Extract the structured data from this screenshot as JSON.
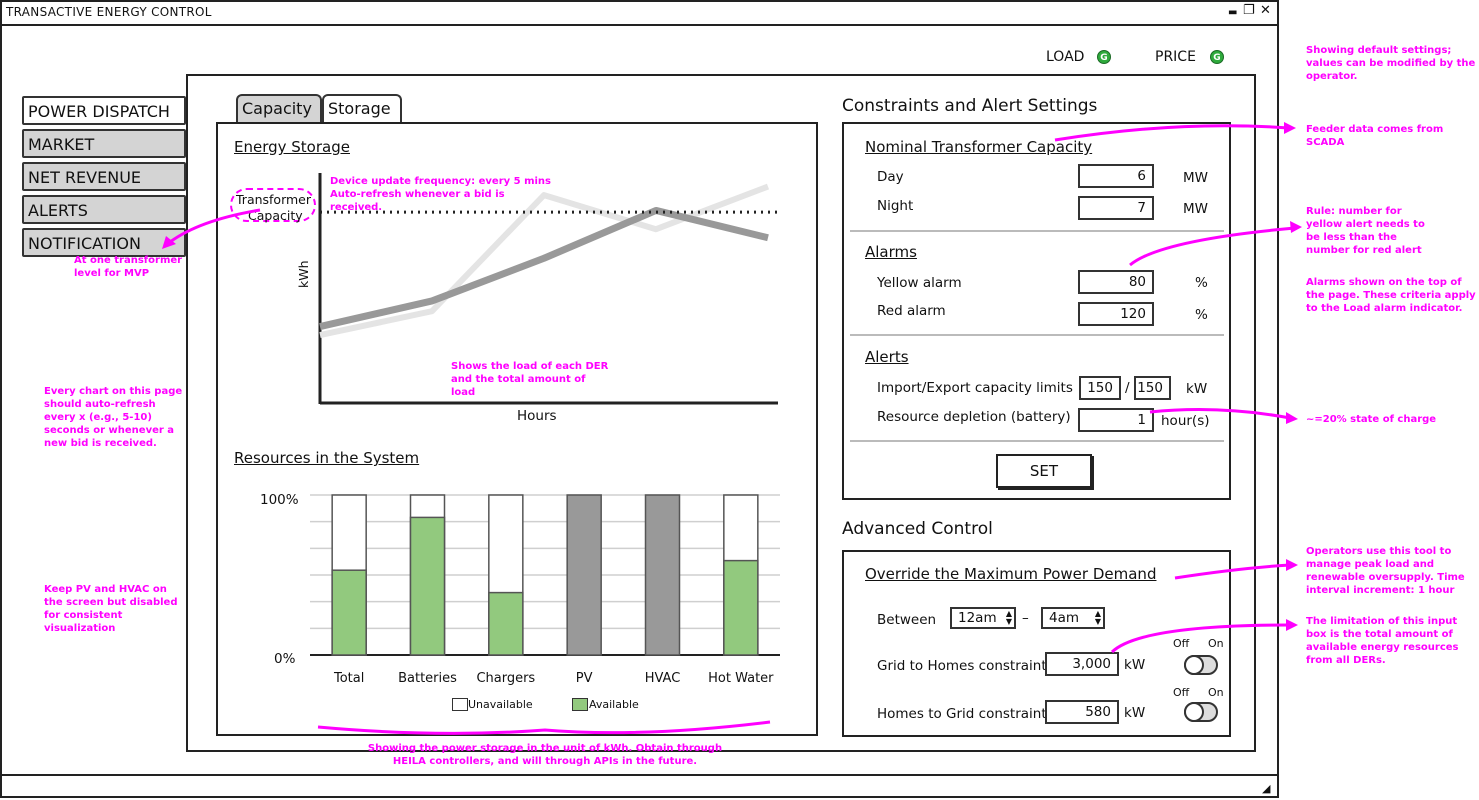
{
  "window": {
    "title": "TRANSACTIVE ENERGY CONTROL",
    "controls": [
      "▬",
      "❐",
      "✕"
    ]
  },
  "status": {
    "load_label": "LOAD",
    "load_indicator": "G",
    "price_label": "PRICE",
    "price_indicator": "G",
    "indicator_color": "#2eaa3c"
  },
  "nav": {
    "items": [
      {
        "label": "POWER DISPATCH",
        "active": true
      },
      {
        "label": "MARKET",
        "active": false
      },
      {
        "label": "NET REVENUE",
        "active": false
      },
      {
        "label": "ALERTS",
        "active": false
      },
      {
        "label": "NOTIFICATION",
        "active": false
      }
    ]
  },
  "tabs": [
    {
      "label": "Capacity",
      "active": false
    },
    {
      "label": "Storage",
      "active": true
    }
  ],
  "energy_storage": {
    "title": "Energy Storage",
    "transformer_label_line1": "Transformer",
    "transformer_label_line2": "Capacity",
    "ylabel": "kWh",
    "xlabel": "Hours"
  },
  "resources": {
    "title": "Resources in the System",
    "tick_top": "100%",
    "tick_bottom": "0%",
    "legend_unavailable": "Unavailable",
    "legend_available": "Available"
  },
  "chart_data": [
    {
      "type": "line",
      "title": "Energy Storage",
      "xlabel": "Hours",
      "ylabel": "kWh",
      "reference_line": "Transformer Capacity",
      "series": [
        {
          "values": [
            0.38,
            0.52,
            1.2,
            1.0,
            1.25
          ]
        },
        {
          "values": [
            0.43,
            0.58,
            0.83,
            1.11,
            0.95
          ]
        }
      ],
      "x": [
        0,
        1,
        2,
        3,
        4
      ],
      "reference_value": 1.1
    },
    {
      "type": "bar",
      "title": "Resources in the System",
      "categories": [
        "Total",
        "Batteries",
        "Chargers",
        "PV",
        "HVAC",
        "Hot Water"
      ],
      "series": [
        {
          "name": "Available",
          "values": [
            53,
            86,
            39,
            0,
            0,
            59
          ]
        },
        {
          "name": "Unavailable",
          "values": [
            47,
            14,
            61,
            0,
            0,
            41
          ]
        }
      ],
      "disabled": [
        false,
        false,
        false,
        true,
        true,
        false
      ],
      "ylim": [
        0,
        100
      ],
      "colors": {
        "available": "#92c97e",
        "unavailable": "#ffffff",
        "disabled": "#999999"
      }
    }
  ],
  "constraints": {
    "heading": "Constraints and Alert Settings",
    "nominal_title": "Nominal Transformer Capacity",
    "day_label": "Day",
    "day_value": "6",
    "day_unit": "MW",
    "night_label": "Night",
    "night_value": "7",
    "night_unit": "MW",
    "alarms_title": "Alarms",
    "yellow_label": "Yellow alarm",
    "yellow_value": "80",
    "yellow_unit": "%",
    "red_label": "Red alarm",
    "red_value": "120",
    "red_unit": "%",
    "alerts_title": "Alerts",
    "import_label": "Import/Export capacity limits",
    "import_value": "150",
    "slash": "/",
    "export_value": "150",
    "import_unit": "kW",
    "depletion_label": "Resource depletion (battery)",
    "depletion_value": "1",
    "depletion_unit": "hour(s)",
    "set_label": "SET"
  },
  "advanced": {
    "heading": "Advanced Control",
    "override_title": "Override the Maximum Power Demand",
    "between_label": "Between",
    "from_value": "12am",
    "dash": "–",
    "to_value": "4am",
    "g2h_label": "Grid to Homes constraint",
    "g2h_value": "3,000",
    "g2h_unit": "kW",
    "h2g_label": "Homes to Grid constraint",
    "h2g_value": "580",
    "h2g_unit": "kW",
    "off_label": "Off",
    "on_label": "On"
  },
  "notes": {
    "default_settings": "Showing default settings; values can be modified by the operator.",
    "feeder": "Feeder data comes from SCADA",
    "rule": "Rule: number for yellow alert needs to be less than the number for red alert",
    "alarms_shown": "Alarms shown on the top of the page. These criteria apply to the Load alarm indicator.",
    "soc": "~=20% state of charge",
    "operators": "Operators use this tool to manage peak load and renewable oversupply. Time interval increment: 1 hour",
    "limitation": "The limitation of this input box is the total amount of available energy resources from all DERs.",
    "device_update": "Device update frequency: every 5 mins Auto-refresh whenever a bid is received.",
    "mvp": "At one transformer level for MVP",
    "shows_load": "Shows the load of each DER and the total amount of load",
    "auto_refresh": "Every chart on this page should auto-refresh every x (e.g., 5-10) seconds or whenever a new bid is received.",
    "keep_pv": "Keep PV and HVAC on the screen but disabled for consistent visualization",
    "storage_note": "Showing the power storage in the unit of kWh. Obtain through HEILA controllers, and will through APIs in the future.",
    "color": "#ff00ff"
  }
}
